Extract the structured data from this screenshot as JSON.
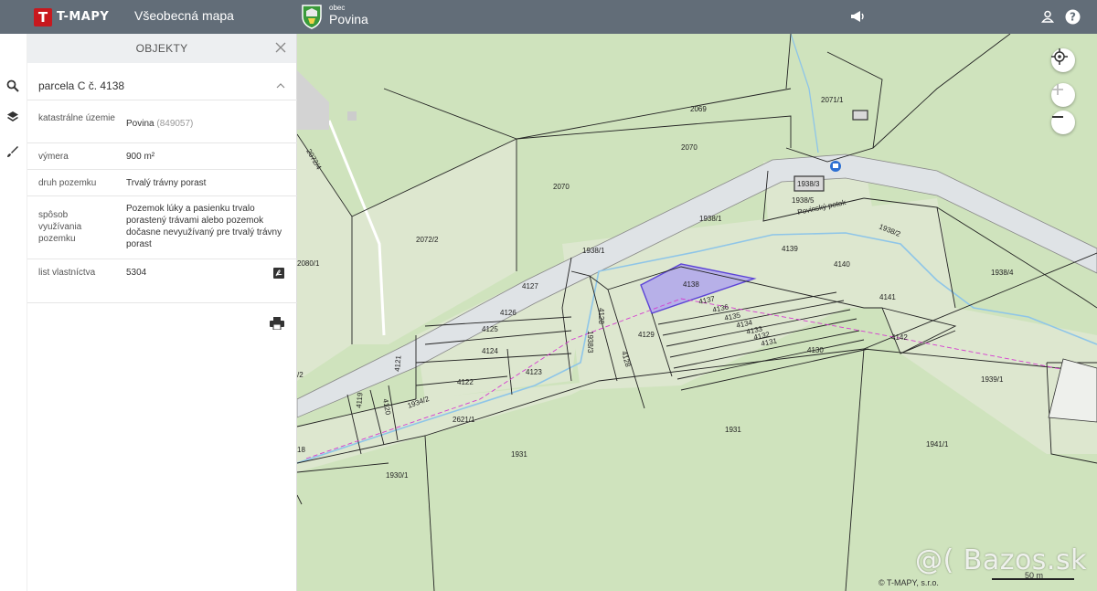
{
  "header": {
    "brand": "T-MAPY",
    "app_title": "Všeobecná mapa",
    "municipality_label": "obec",
    "municipality_name": "Povina"
  },
  "panel": {
    "title": "OBJEKTY",
    "parcel_title": "parcela C č. 4138",
    "rows": [
      {
        "label": "katastrálne územie",
        "value": "Povina",
        "value_extra": "(849057)"
      },
      {
        "label": "výmera",
        "value": "900 m²"
      },
      {
        "label": "druh pozemku",
        "value": "Trvalý trávny porast"
      },
      {
        "label": "spôsob využívania pozemku",
        "value": "Pozemok lúky a pasienku trvalo porastený trávami alebo pozemok dočasne nevyužívaný pre trvalý trávny porast"
      },
      {
        "label": "list vlastníctva",
        "value": "5304"
      }
    ]
  },
  "map": {
    "parcel_labels": {
      "p2069": "2069",
      "p2070a": "2070",
      "p2070b": "2070",
      "p2071": "2071/1",
      "p2072": "2072/2",
      "p20724": "2072/4",
      "p19383": "1938/3",
      "p19385": "1938/5",
      "stream": "Povinský potok",
      "p19381": "1938/1",
      "p19382": "1938/2",
      "p19381b": "1938/1",
      "p4139": "4139",
      "p4140": "4140",
      "p19384": "1938/4",
      "p4141": "4141",
      "p4127": "4127",
      "p4138": "4138",
      "p4137": "4137",
      "p4136": "4136",
      "p4135": "4135",
      "p4134": "4134",
      "p4133": "4133",
      "p4132": "4132",
      "p4131": "4131",
      "p4126": "4126",
      "p4125": "4125",
      "p4124": "4124",
      "p4128": "4128",
      "p4128b": "4128",
      "p19363": "1938/3",
      "p4129": "4129",
      "p4130": "4130",
      "p4142": "4142",
      "p4123": "4123",
      "p4122": "4122",
      "p4121": "4121",
      "p4120": "4120",
      "p4119": "4119",
      "p19342": "1934/2",
      "p26211": "2621/1",
      "p19391": "1939/1",
      "p1931a": "1931",
      "p1931b": "1931",
      "p19411": "1941/1",
      "p19301": "1930/1",
      "p20801": "2080/1",
      "p2": "/2",
      "p18": "18"
    },
    "scale": "50 m",
    "copyright": "© T-MAPY, s.r.o.",
    "watermark": "@( Bazos.sk",
    "colors": {
      "field": "#cfe3bd",
      "parcel_light": "#dde7cf",
      "road": "#dfe3e6",
      "selected": "#b7b0e8",
      "boundary": "#222222",
      "stream": "#8ec5e8",
      "header": "#626d78",
      "brand": "#c8181e"
    }
  }
}
